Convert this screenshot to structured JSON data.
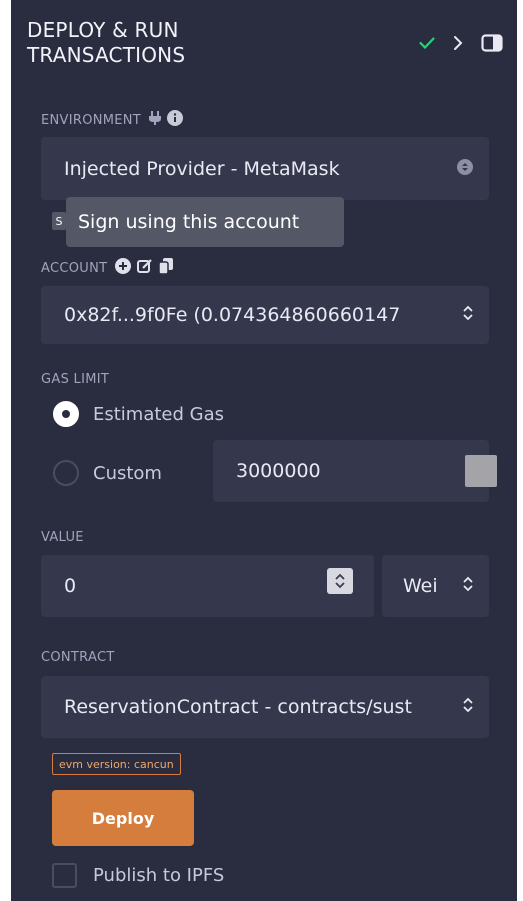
{
  "header": {
    "title": "DEPLOY & RUN TRANSACTIONS"
  },
  "environment": {
    "label": "ENVIRONMENT",
    "value": "Injected Provider - MetaMask",
    "icon_plug": "plug-icon",
    "icon_info": "info-icon"
  },
  "tooltip": {
    "text": "Sign using this account",
    "peek": "S"
  },
  "account": {
    "label": "ACCOUNT",
    "value": "0x82f...9f0Fe (0.074364860660147"
  },
  "gas": {
    "label": "GAS LIMIT",
    "estimated_label": "Estimated Gas",
    "custom_label": "Custom",
    "custom_value": "3000000"
  },
  "value": {
    "label": "VALUE",
    "amount": "0",
    "unit": "Wei"
  },
  "contract": {
    "label": "CONTRACT",
    "value": "ReservationContract - contracts/sust"
  },
  "evm_badge": "evm version: cancun",
  "deploy_label": "Deploy",
  "publish_label": "Publish to IPFS",
  "colors": {
    "panel": "#2a2c3f",
    "field": "#35384c",
    "accent": "#d57d3c",
    "check": "#2bd173"
  }
}
